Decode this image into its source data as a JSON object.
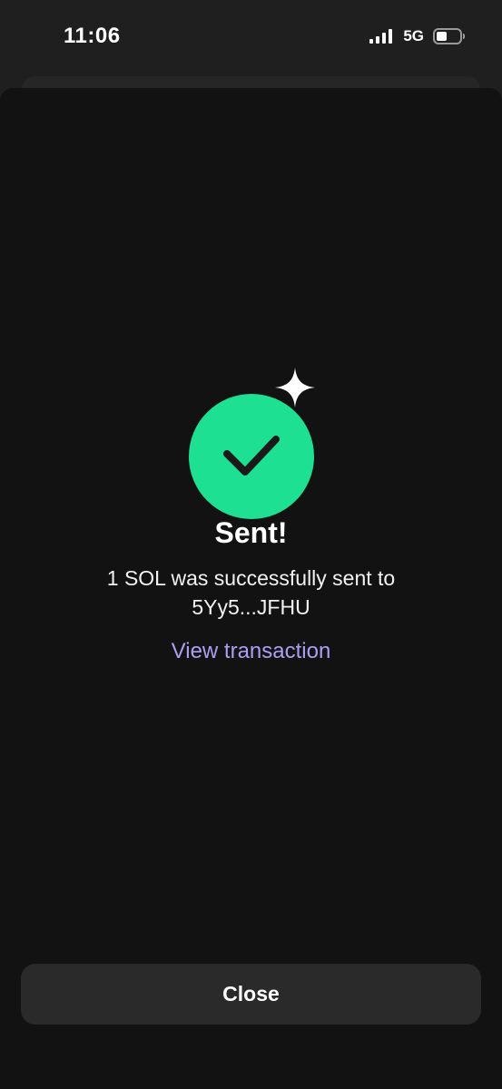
{
  "status_bar": {
    "time": "11:06",
    "network": "5G",
    "signal_bars": 4,
    "battery_level": 0.45
  },
  "success": {
    "icon": "checkmark-icon",
    "accent_color": "#1ee092",
    "title": "Sent!",
    "message_line1": "1 SOL was successfully sent to",
    "message_line2": "5Yy5...JFHU",
    "link_label": "View transaction",
    "link_color": "#ab9ff2"
  },
  "footer": {
    "close_label": "Close"
  }
}
